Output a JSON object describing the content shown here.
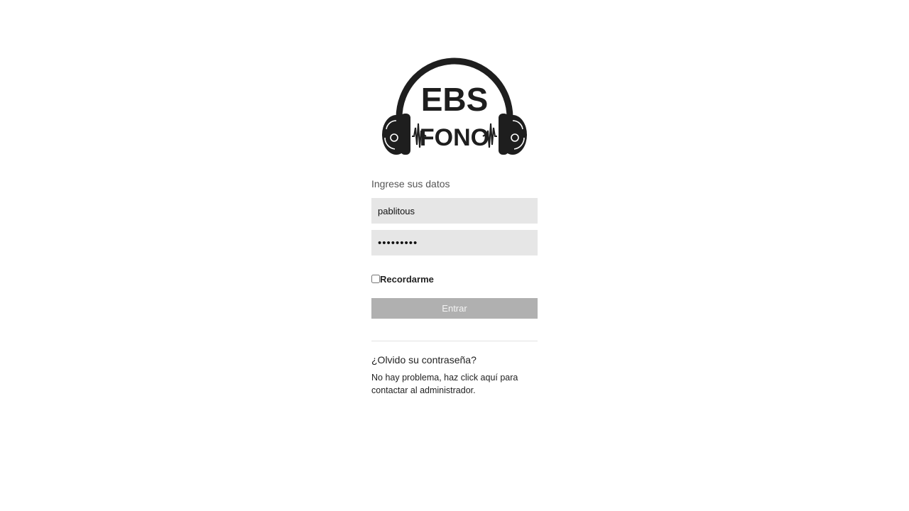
{
  "logo": {
    "line1": "EBS",
    "line2": "FONO"
  },
  "login": {
    "title": "Ingrese sus datos",
    "username_value": "pablitous",
    "password_value": "•••••••••",
    "remember_label": "Recordarme",
    "remember_checked": false,
    "submit_label": "Entrar"
  },
  "forgot": {
    "title": "¿Olvido su contraseña?",
    "text": "No hay problema, haz click aquí para contactar al administrador."
  },
  "colors": {
    "field_background": "#e6e6e6",
    "button_background": "#b0b0b0",
    "logo": "#1e1e1e"
  }
}
